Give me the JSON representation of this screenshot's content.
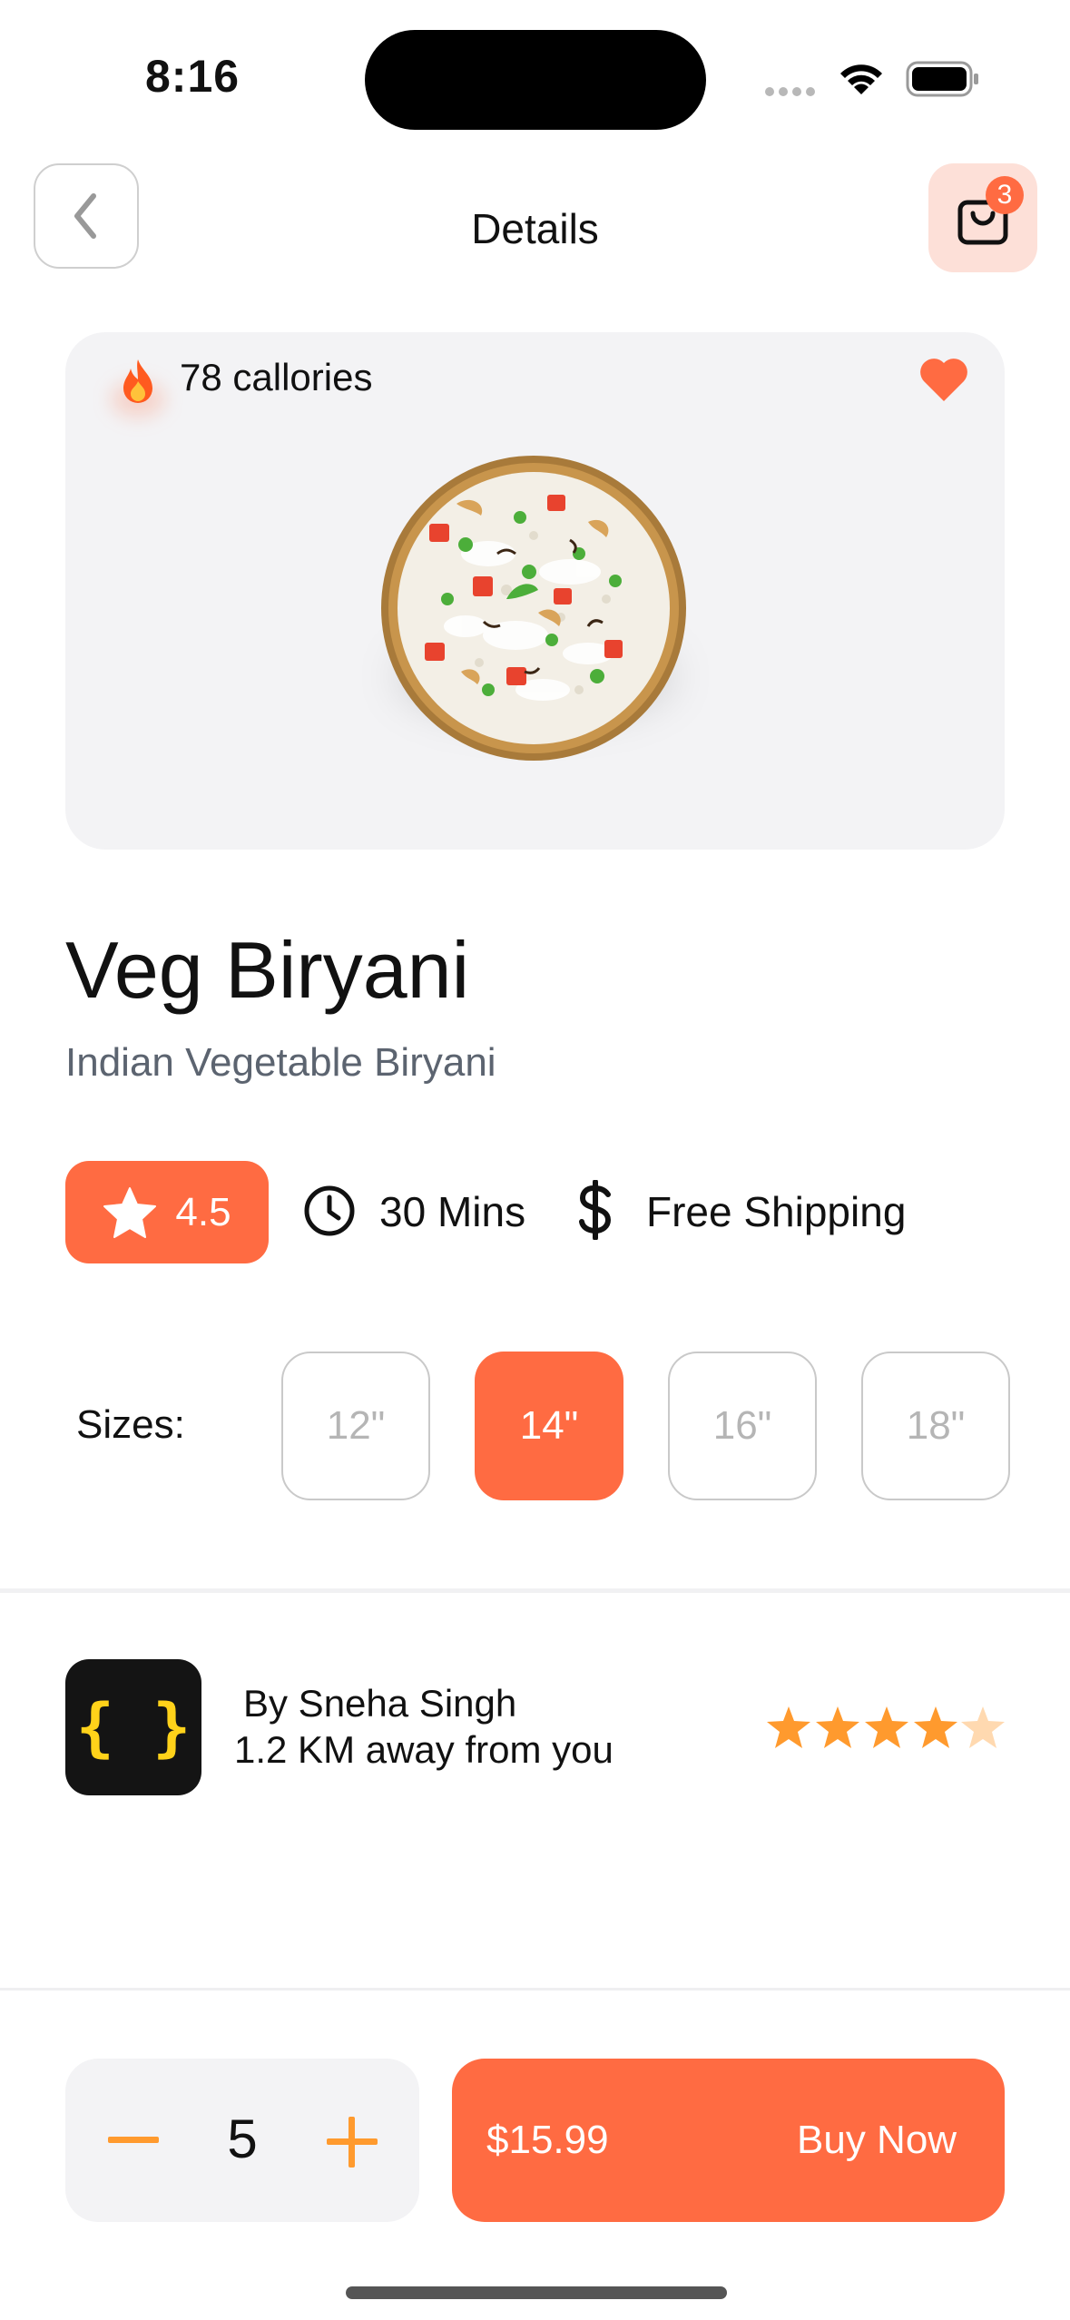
{
  "status_bar": {
    "time": "8:16"
  },
  "header": {
    "title": "Details",
    "cart_count": "3",
    "back_icon": "chevron-left-icon",
    "cart_icon": "shopping-bag-icon"
  },
  "hero": {
    "calories_text": "78 callories",
    "calories_icon": "fire-icon",
    "favorite_icon": "heart-icon",
    "favorite_color": "#ff6b42"
  },
  "dish": {
    "title": "Veg Biryani",
    "subtitle": "Indian Vegetable Biryani"
  },
  "info": {
    "rating": "4.5",
    "time": "30 Mins",
    "shipping": "Free Shipping"
  },
  "sizes": {
    "label": "Sizes:",
    "options": [
      "12\"",
      "14\"",
      "16\"",
      "18\""
    ],
    "selected": "14\""
  },
  "vendor": {
    "name": "By Sneha Singh",
    "distance": "1.2 KM away from you",
    "stars": 4.5,
    "logo_icon": "curly-braces-icon"
  },
  "bottom": {
    "quantity": "5",
    "price": "$15.99",
    "buy_label": "Buy Now"
  },
  "colors": {
    "accent": "#ff6b42",
    "accent_light": "#fde0d8",
    "star": "#ff9a2e",
    "qty_icon": "#ff9a2e"
  }
}
